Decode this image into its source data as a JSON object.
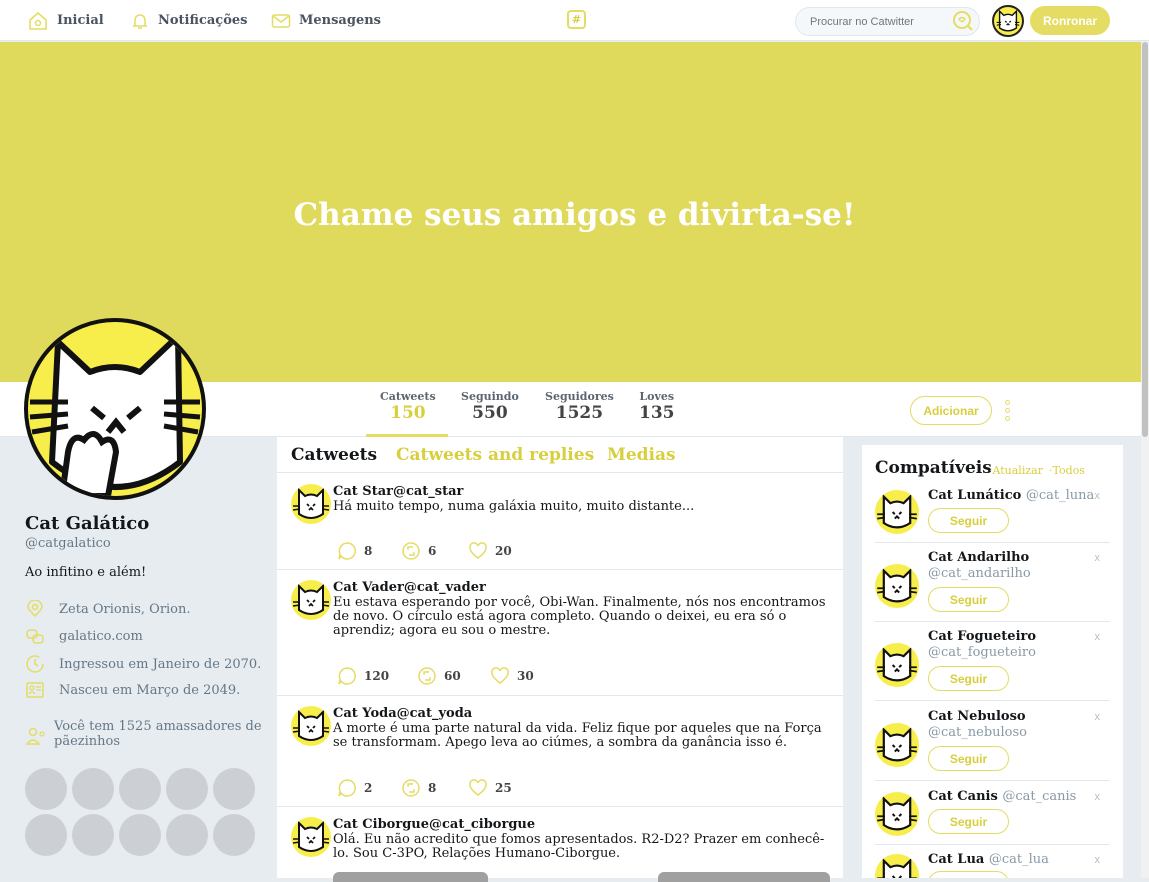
{
  "colors": {
    "accent": "#e4dc63",
    "banner": "#e0da5c",
    "text": "#14171a",
    "muted": "#657786"
  },
  "nav": {
    "items": [
      {
        "label": "Inicial",
        "icon": "home-icon"
      },
      {
        "label": "Notificações",
        "icon": "bell-icon"
      },
      {
        "label": "Mensagens",
        "icon": "mail-icon"
      }
    ],
    "center_icon": "#",
    "search_placeholder": "Procurar no Catwitter",
    "cta": "Ronronar"
  },
  "banner": {
    "text": "Chame seus amigos e divirta-se!"
  },
  "stats": [
    {
      "label": "Catweets",
      "value": "150"
    },
    {
      "label": "Seguindo",
      "value": "550"
    },
    {
      "label": "Seguidores",
      "value": "1525"
    },
    {
      "label": "Loves",
      "value": "135"
    }
  ],
  "add_button": "Adicionar",
  "profile": {
    "name": "Cat Galático",
    "handle": "@catgalatico",
    "bio": "Ao infitino e além!",
    "location": "Zeta Orionis, Orion.",
    "website": "galatico.com",
    "joined": "Ingressou em Janeiro de 2070.",
    "born": "Nasceu em Março de 2049.",
    "followers_text": "Você tem 1525 amassadores de pãezinhos"
  },
  "tabs": [
    "Catweets",
    "Catweets and replies",
    "Medias"
  ],
  "tweets": [
    {
      "name": "Cat Star@cat_star",
      "text": "Há muito tempo, numa galáxia muito, muito distante...",
      "replies": "8",
      "retweets": "6",
      "likes": "20"
    },
    {
      "name": "Cat Vader@cat_vader",
      "text": "Eu estava esperando por você, Obi-Wan. Finalmente, nós nos encontramos de novo. O círculo está agora completo. Quando o deixei, eu era só o aprendiz; agora eu sou o mestre.",
      "replies": "120",
      "retweets": "60",
      "likes": "30"
    },
    {
      "name": "Cat Yoda@cat_yoda",
      "text": "A morte é uma parte natural da vida. Feliz fique por aqueles que na Força se transformam. Apego leva ao ciúmes, a sombra da ganância isso é.",
      "replies": "2",
      "retweets": "8",
      "likes": "25"
    },
    {
      "name": "Cat Ciborgue@cat_ciborgue",
      "text": "Olá. Eu não acredito que fomos apresentados. R2-D2? Prazer em conhecê-lo. Sou C-3PO, Relações Humano-Ciborgue."
    }
  ],
  "sidebar": {
    "title": "Compatíveis",
    "refresh": "·Atualizar",
    "all": "·Todos",
    "follow_label": "Seguir",
    "close": "x",
    "suggestions": [
      {
        "name": "Cat Lunático",
        "handle": "@cat_luna"
      },
      {
        "name": "Cat Andarilho",
        "handle": "@cat_andarilho"
      },
      {
        "name": "Cat Fogueteiro",
        "handle": "@cat_fogueteiro"
      },
      {
        "name": "Cat Nebuloso",
        "handle": "@cat_nebuloso"
      },
      {
        "name": "Cat Canis",
        "handle": "@cat_canis"
      },
      {
        "name": "Cat Lua",
        "handle": "@cat_lua"
      }
    ]
  }
}
